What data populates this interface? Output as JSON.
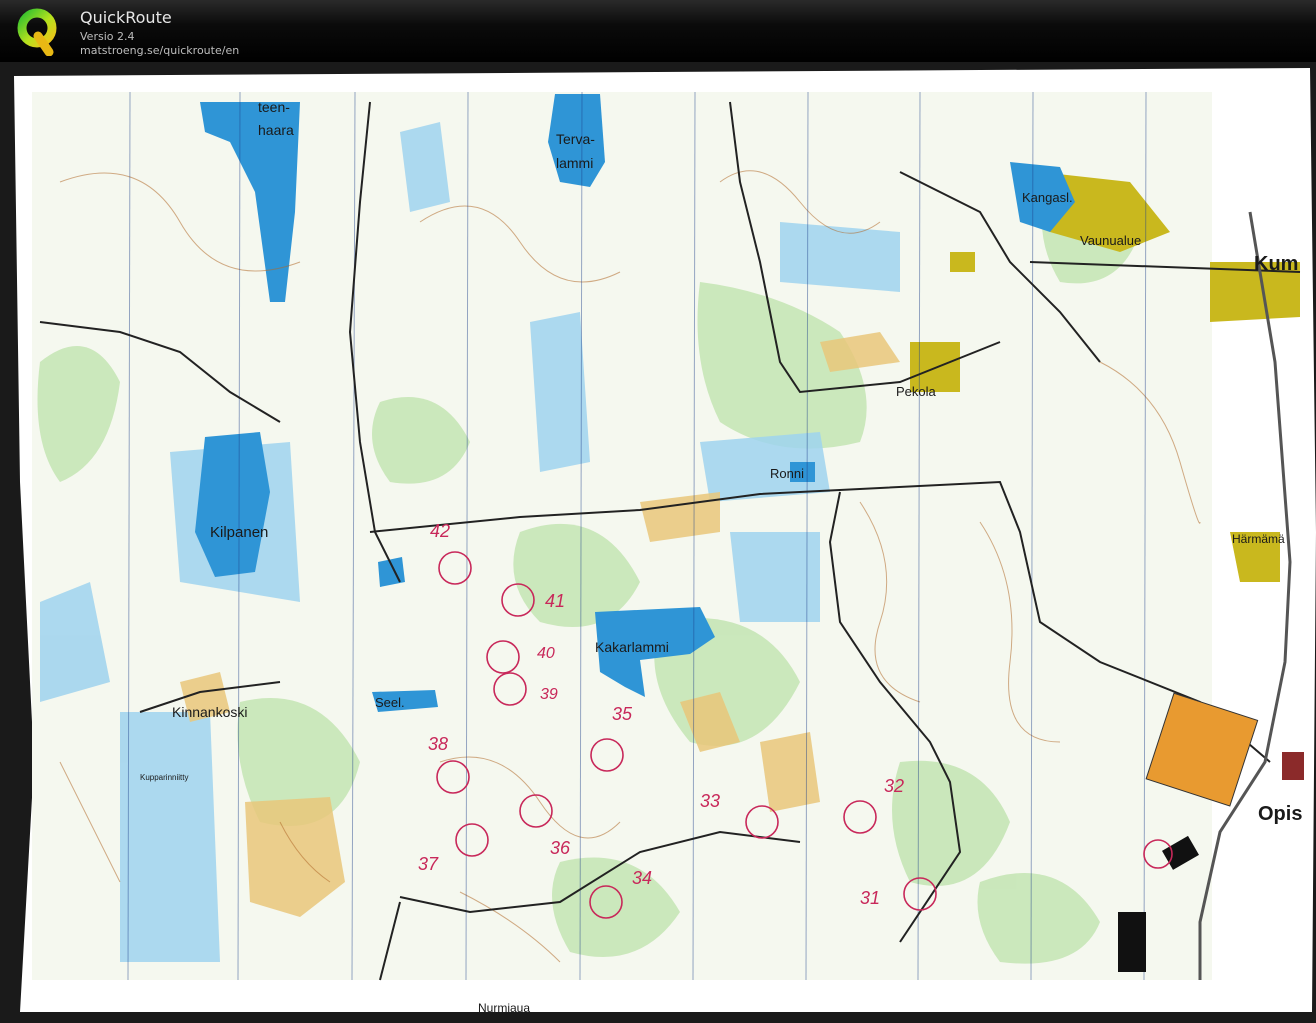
{
  "app": {
    "title": "QuickRoute",
    "version": "Versio 2.4",
    "url": "matstroeng.se/quickroute/en",
    "logo_letter": "Q"
  },
  "colors": {
    "titlebar": "#000000",
    "paper": "#ffffff",
    "water": "#2f95d6",
    "marsh": "#3aa3d8",
    "forest_green": "#bfe3b0",
    "open_yellow": "#e9c77a",
    "settlement": "#c9b81e",
    "contour": "#b06a2a",
    "course_magenta": "#c8285a",
    "road": "#222222"
  },
  "map": {
    "place_labels": [
      "teen-",
      "haara",
      "Terva-",
      "lammi",
      "Kangasl.",
      "Vaunualue",
      "Kum",
      "Pekola",
      "Ronni",
      "Kilpanen",
      "Kakarlammi",
      "Seel.",
      "Kinnankoski",
      "Kupparinniitty",
      "Härmämä",
      "Opis",
      "Nurmiaua"
    ],
    "control_numbers": [
      "42",
      "41",
      "40",
      "39",
      "38",
      "37",
      "36",
      "35",
      "34",
      "33",
      "32",
      "31"
    ]
  }
}
